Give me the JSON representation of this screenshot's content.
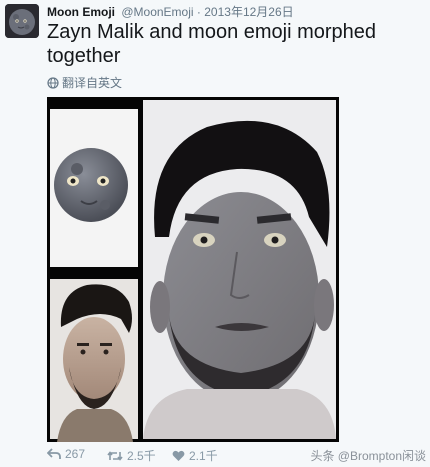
{
  "tweet": {
    "author_name": "Moon Emoji",
    "handle": "@MoonEmoji",
    "separator": "·",
    "date": "2013年12月26日",
    "text": "Zayn Malik and moon emoji morphed together",
    "translate_label": "翻译自英文"
  },
  "actions": {
    "reply_count": "267",
    "retweet_count": "2.5千",
    "like_count": "2.1千"
  },
  "watermark": "头条 @Brompton闲谈",
  "icons": {
    "avatar": "moon-emoji-avatar",
    "globe": "globe-icon",
    "reply": "reply-icon",
    "retweet": "retweet-icon",
    "like": "heart-icon"
  },
  "colors": {
    "background": "#f5f8fa",
    "text": "#14171a",
    "muted": "#657786"
  }
}
